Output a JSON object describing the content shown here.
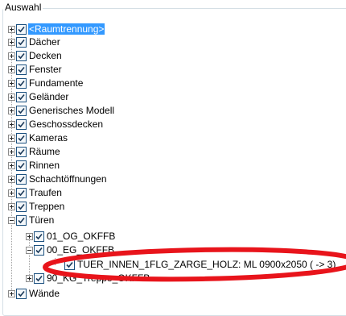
{
  "groupbox": {
    "title": "Auswahl"
  },
  "tree": {
    "root_items": [
      {
        "label": "<Raumtrennung>",
        "checked": true,
        "expanded": false,
        "selected": true
      },
      {
        "label": "Dächer",
        "checked": true,
        "expanded": false
      },
      {
        "label": "Decken",
        "checked": true,
        "expanded": false
      },
      {
        "label": "Fenster",
        "checked": true,
        "expanded": false
      },
      {
        "label": "Fundamente",
        "checked": true,
        "expanded": false
      },
      {
        "label": "Geländer",
        "checked": true,
        "expanded": false
      },
      {
        "label": "Generisches Modell",
        "checked": true,
        "expanded": false
      },
      {
        "label": "Geschossdecken",
        "checked": true,
        "expanded": false
      },
      {
        "label": "Kameras",
        "checked": true,
        "expanded": false
      },
      {
        "label": "Räume",
        "checked": true,
        "expanded": false
      },
      {
        "label": "Rinnen",
        "checked": true,
        "expanded": false
      },
      {
        "label": "Schachtöffnungen",
        "checked": true,
        "expanded": false
      },
      {
        "label": "Traufen",
        "checked": true,
        "expanded": false
      },
      {
        "label": "Treppen",
        "checked": true,
        "expanded": false
      },
      {
        "label": "Türen",
        "checked": true,
        "expanded": true
      },
      {
        "label": "Wände",
        "checked": true,
        "expanded": false
      }
    ],
    "tueren_children": [
      {
        "label": "01_OG_OKFFB",
        "checked": true,
        "expanded": false
      },
      {
        "label": "00_EG_OKFFB",
        "checked": true,
        "expanded": true
      },
      {
        "label": "90_KG_Treppe_OKFFB",
        "checked": true,
        "expanded": false
      }
    ],
    "eg_children": [
      {
        "label": "TUER_INNEN_1FLG_ZARGE_HOLZ: ML 0900x2050 ( -> 3)",
        "checked": true
      }
    ]
  },
  "annotation": {
    "color": "#e8141b"
  }
}
